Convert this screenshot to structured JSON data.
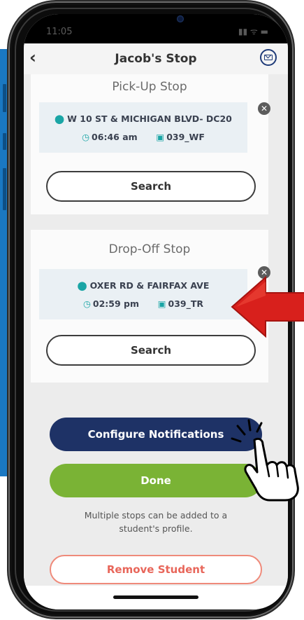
{
  "status_bar": {
    "time": "11:05"
  },
  "header": {
    "back_glyph": "‹",
    "title": "Jacob's Stop",
    "mail_icon": "mail-icon"
  },
  "pickup": {
    "title": "Pick-Up Stop",
    "stop_name": "W 10 ST & MICHIGAN BLVD- DC20",
    "time": "06:46 am",
    "route": "039_WF",
    "search_label": "Search"
  },
  "dropoff": {
    "title": "Drop-Off Stop",
    "stop_name": "OXER RD & FAIRFAX AVE",
    "time": "02:59 pm",
    "route": "039_TR",
    "search_label": "Search"
  },
  "actions": {
    "configure_label": "Configure Notifications",
    "done_label": "Done",
    "note_line1": "Multiple stops can be added to a",
    "note_line2": "student's profile.",
    "remove_label": "Remove Student"
  },
  "colors": {
    "accent_teal": "#1aa5a5",
    "navy": "#1e3266",
    "green": "#7ab335",
    "remove_red": "#e8665a",
    "arrow_red": "#d8201c"
  }
}
